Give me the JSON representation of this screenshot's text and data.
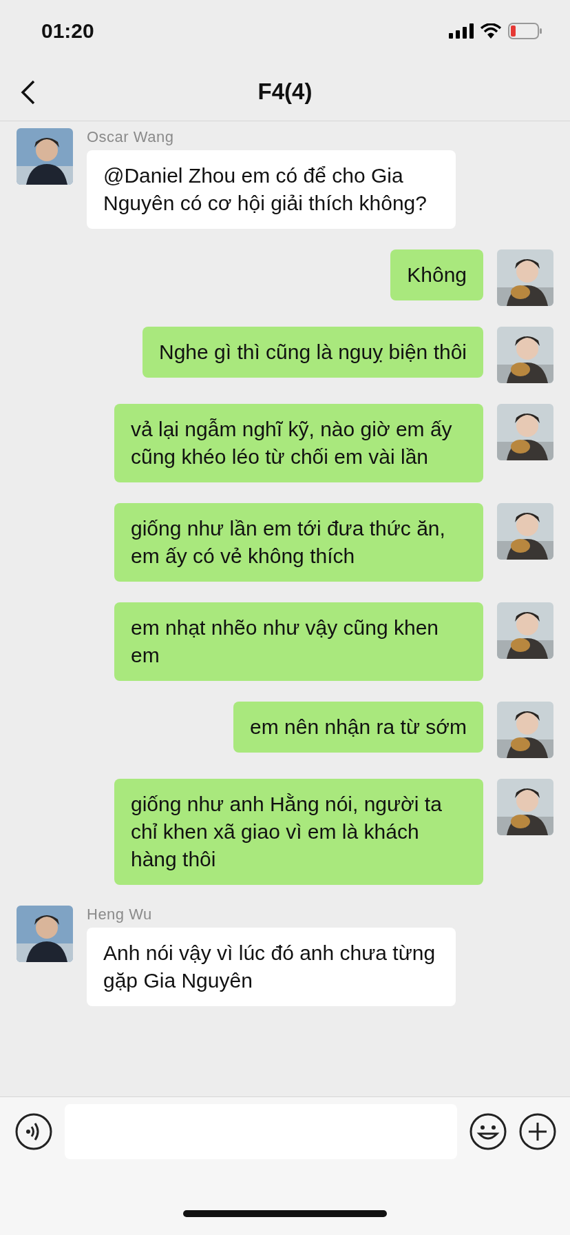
{
  "status_bar": {
    "time": "01:20"
  },
  "nav": {
    "title": "F4(4)"
  },
  "messages": [
    {
      "kind": "incoming",
      "sender": "Oscar Wang",
      "text": "@Daniel Zhou em có để cho Gia Nguyên có cơ hội giải thích không?"
    },
    {
      "kind": "outgoing",
      "text": "Không"
    },
    {
      "kind": "outgoing",
      "text": "Nghe gì thì cũng là nguỵ biện thôi"
    },
    {
      "kind": "outgoing",
      "text": "vả lại ngẫm nghĩ kỹ, nào giờ em ấy cũng khéo léo từ chối em vài lần"
    },
    {
      "kind": "outgoing",
      "text": "giống như lần em tới đưa thức ăn, em ấy có vẻ không thích"
    },
    {
      "kind": "outgoing",
      "text": "em nhạt nhẽo như vậy cũng khen em"
    },
    {
      "kind": "outgoing",
      "text": "em nên nhận ra từ sớm"
    },
    {
      "kind": "outgoing",
      "text": "giống như anh Hằng nói, người ta chỉ khen xã giao vì em là khách hàng thôi"
    },
    {
      "kind": "incoming",
      "sender": "Heng Wu",
      "text": "Anh nói vậy vì lúc đó anh chưa từng gặp Gia Nguyên"
    }
  ]
}
